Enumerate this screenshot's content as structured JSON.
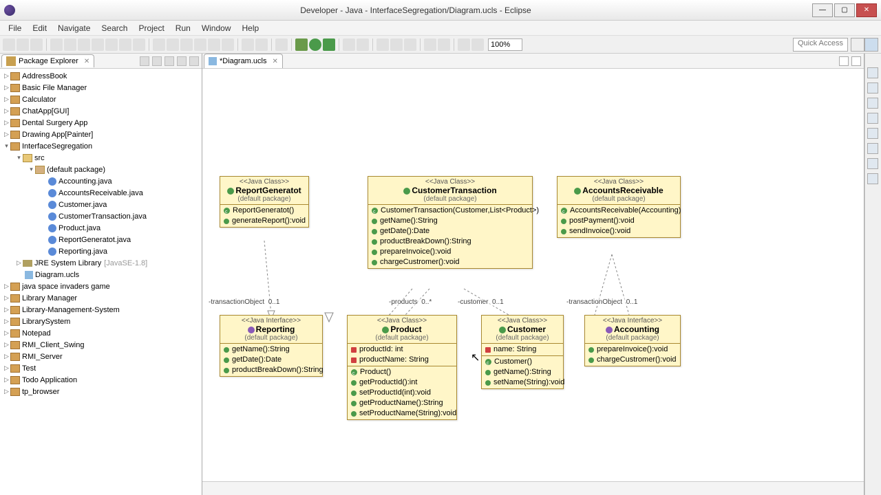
{
  "window": {
    "title": "Developer - Java - InterfaceSegregation/Diagram.ucls - Eclipse"
  },
  "menu": [
    "File",
    "Edit",
    "Navigate",
    "Search",
    "Project",
    "Run",
    "Window",
    "Help"
  ],
  "zoom": "100%",
  "quickAccess": "Quick Access",
  "explorer": {
    "title": "Package Explorer",
    "projects": [
      "AddressBook",
      "Basic File Manager",
      "Calculator",
      "ChatApp[GUI]",
      "Dental Surgery App",
      "Drawing App[Painter]"
    ],
    "expanded": {
      "name": "InterfaceSegregation",
      "src": "src",
      "pkg": "(default package)",
      "files": [
        "Accounting.java",
        "AccountsReceivable.java",
        "Customer.java",
        "CustomerTransaction.java",
        "Product.java",
        "ReportGeneratot.java",
        "Reporting.java"
      ],
      "lib": "JRE System Library",
      "libDeco": "[JavaSE-1.8]",
      "diagram": "Diagram.ucls"
    },
    "rest": [
      "java space invaders game",
      "Library Manager",
      "Library-Management-System",
      "LibrarySystem",
      "Notepad",
      "RMI_Client_Swing",
      "RMI_Server",
      "Test",
      "Todo Application",
      "tp_browser"
    ]
  },
  "editor": {
    "tab": "*Diagram.ucls"
  },
  "uml": {
    "reportGen": {
      "stereo": "<<Java Class>>",
      "name": "ReportGeneratot",
      "pkg": "(default package)",
      "methods": [
        "ReportGeneratot()",
        "generateReport():void"
      ]
    },
    "custTrans": {
      "stereo": "<<Java Class>>",
      "name": "CustomerTransaction",
      "pkg": "(default package)",
      "methods": [
        "CustomerTransaction(Customer,List<Product>)",
        "getName():String",
        "getDate():Date",
        "productBreakDown():String",
        "prepareInvoice():void",
        "chargeCustromer():void"
      ]
    },
    "acctRecv": {
      "stereo": "<<Java Class>>",
      "name": "AccountsReceivable",
      "pkg": "(default package)",
      "methods": [
        "AccountsReceivable(Accounting)",
        "postPayment():void",
        "sendInvoice():void"
      ]
    },
    "reporting": {
      "stereo": "<<Java Interface>>",
      "name": "Reporting",
      "pkg": "(default package)",
      "methods": [
        "getName():String",
        "getDate():Date",
        "productBreakDown():String"
      ]
    },
    "product": {
      "stereo": "<<Java Class>>",
      "name": "Product",
      "pkg": "(default package)",
      "attrs": [
        "productId: int",
        "productName: String"
      ],
      "methods": [
        "Product()",
        "getProductId():int",
        "setProductId(int):void",
        "getProductName():String",
        "setProductName(String):void"
      ]
    },
    "customer": {
      "stereo": "<<Java Class>>",
      "name": "Customer",
      "pkg": "(default package)",
      "attrs": [
        "name: String"
      ],
      "methods": [
        "Customer()",
        "getName():String",
        "setName(String):void"
      ]
    },
    "accounting": {
      "stereo": "<<Java Interface>>",
      "name": "Accounting",
      "pkg": "(default package)",
      "methods": [
        "prepareInvoice():void",
        "chargeCustromer():void"
      ]
    }
  },
  "assoc": {
    "a1": "-transactionObject",
    "a1m": "0..1",
    "a2": "-products",
    "a2m": "0..*",
    "a3": "-customer",
    "a3m": "0..1",
    "a4": "-transactionObject",
    "a4m": "0..1"
  }
}
